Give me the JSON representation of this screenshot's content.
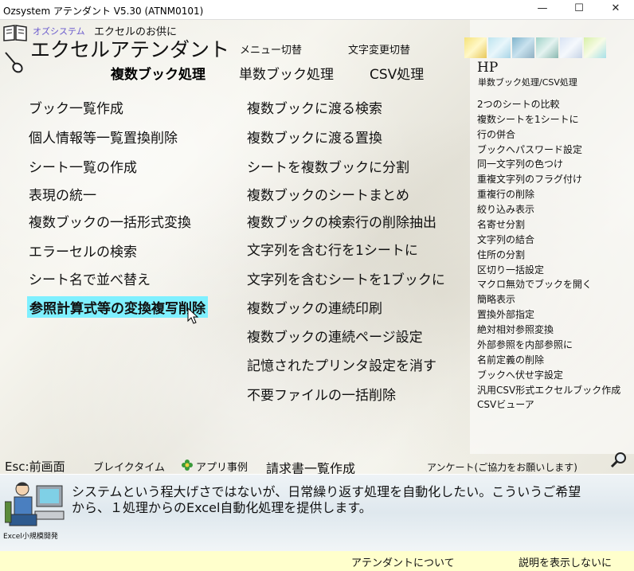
{
  "window": {
    "title": "Ozsystem アテンダント V5.30 (ATNM0101)",
    "minimize": "—",
    "maximize": "☐",
    "close": "✕"
  },
  "header": {
    "subtitle_kana": "オズシステム",
    "subtitle": "エクセルのお供に",
    "app_name": "エクセルアテンダント",
    "menu_switch": "メニュー切替",
    "char_change_switch": "文字変更切替",
    "hp": "HP",
    "hp_sub": "単数ブック処理/CSV処理"
  },
  "tabs": [
    {
      "label": "複数ブック処理",
      "active": true
    },
    {
      "label": "単数ブック処理",
      "active": false
    },
    {
      "label": "CSV処理",
      "active": false
    }
  ],
  "left_menu": [
    "ブック一覧作成",
    "個人情報等一覧置換削除",
    "シート一覧の作成",
    "表現の統一",
    "複数ブックの一括形式変換",
    "エラーセルの検索",
    "シート名で並べ替え",
    "参照計算式等の変換複写削除"
  ],
  "middle_menu": [
    "複数ブックに渡る検索",
    "複数ブックに渡る置換",
    "シートを複数ブックに分割",
    "複数ブックのシートまとめ",
    "複数ブックの検索行の削除抽出",
    "文字列を含む行を1シートに",
    "文字列を含むシートを1ブックに",
    "複数ブックの連続印刷",
    "複数ブックの連続ページ設定",
    "記憶されたプリンタ設定を消す",
    "不要ファイルの一括削除"
  ],
  "right_menu": [
    "2つのシートの比較",
    "複数シートを1シートに",
    "行の併合",
    "ブックへパスワード設定",
    "同一文字列の色つけ",
    "重複文字列のフラグ付け",
    "重複行の削除",
    "絞り込み表示",
    "名寄せ分割",
    "文字列の結合",
    "住所の分割",
    "区切り一括設定",
    "マクロ無効でブックを開く",
    "簡略表示",
    "置換外部指定",
    "絶対相対参照変換",
    "外部参照を内部参照に",
    "名前定義の削除",
    "ブックへ伏せ字設定",
    "汎用CSV形式エクセルブック作成",
    "CSVビューア"
  ],
  "footer_links": {
    "esc": "Esc:前画面",
    "break": "ブレイクタイム",
    "app_examples": "アプリ事例",
    "invoice": "請求書一覧作成",
    "survey": "アンケート(ご協力をお願いします)"
  },
  "description": {
    "line1": "システムという程大げさではないが、日常繰り返す処理を自動化したい。こういうご希望",
    "line2": "から、１処理からのExcel自動化処理を提供します。",
    "caption": "Excel小規模開発"
  },
  "status": {
    "about": "アテンダントについて",
    "hide_desc": "説明を表示しないに"
  },
  "colors": {
    "highlight": "#7ff0ff",
    "status_bg": "#ffffcc",
    "tab_active": "#000000",
    "kana_accent": "#6a5acd"
  }
}
